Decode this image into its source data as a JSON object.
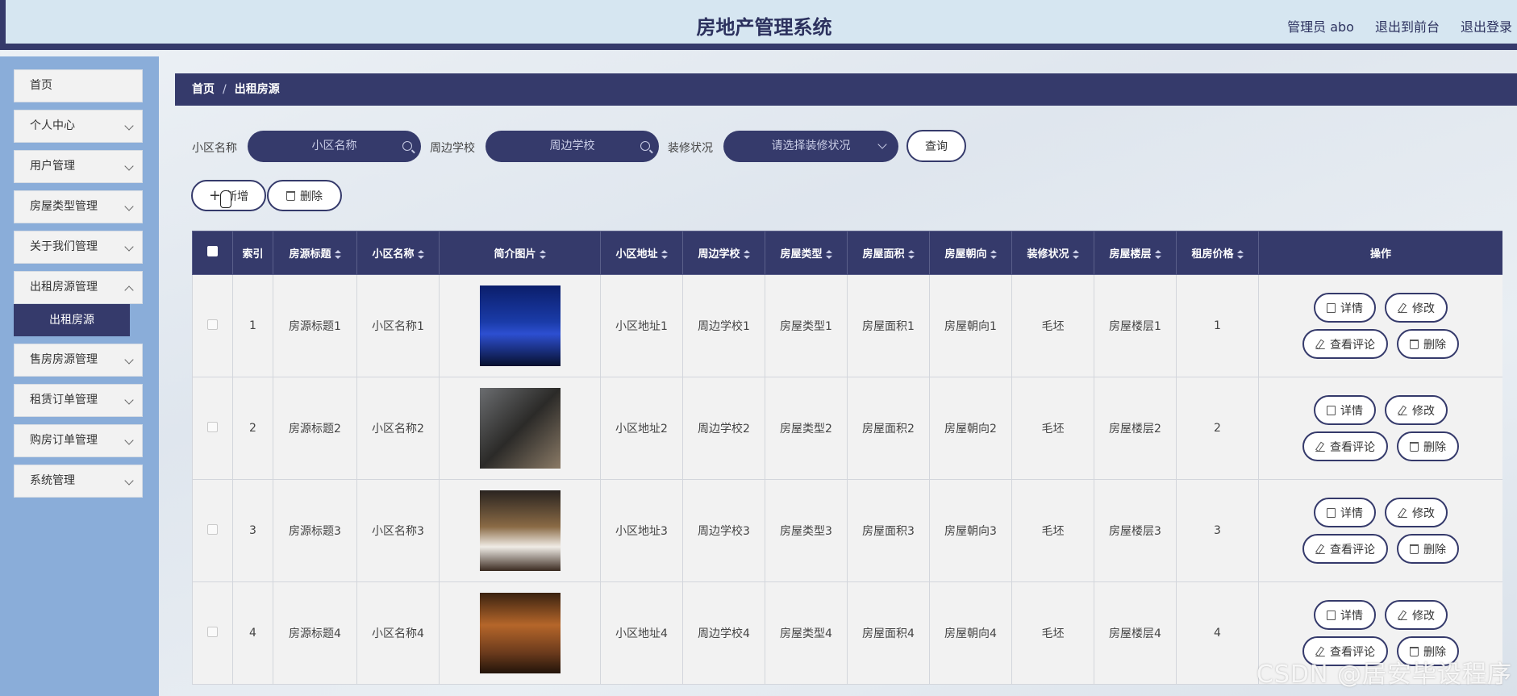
{
  "header": {
    "title": "房地产管理系统",
    "admin_label": "管理员 abo",
    "front_label": "退出到前台",
    "logout_label": "退出登录"
  },
  "sidebar": {
    "items": [
      {
        "label": "首页",
        "has_children": false
      },
      {
        "label": "个人中心",
        "has_children": true
      },
      {
        "label": "用户管理",
        "has_children": true
      },
      {
        "label": "房屋类型管理",
        "has_children": true
      },
      {
        "label": "关于我们管理",
        "has_children": true
      },
      {
        "label": "出租房源管理",
        "has_children": true
      },
      {
        "label": "售房房源管理",
        "has_children": true
      },
      {
        "label": "租赁订单管理",
        "has_children": true
      },
      {
        "label": "购房订单管理",
        "has_children": true
      },
      {
        "label": "系统管理",
        "has_children": true
      }
    ],
    "active_sub": "出租房源"
  },
  "breadcrumb": {
    "home": "首页",
    "sep": "/",
    "current": "出租房源"
  },
  "search": {
    "community_label": "小区名称",
    "community_placeholder": "小区名称",
    "school_label": "周边学校",
    "school_placeholder": "周边学校",
    "decoration_label": "装修状况",
    "decoration_placeholder": "请选择装修状况",
    "query_button": "查询"
  },
  "actions": {
    "add_label": "新增",
    "delete_label": "删除"
  },
  "table": {
    "columns": [
      "索引",
      "房源标题",
      "小区名称",
      "简介图片",
      "小区地址",
      "周边学校",
      "房屋类型",
      "房屋面积",
      "房屋朝向",
      "装修状况",
      "房屋楼层",
      "租房价格",
      "操作"
    ],
    "rows": [
      {
        "index": "1",
        "title": "房源标题1",
        "community": "小区名称1",
        "address": "小区地址1",
        "school": "周边学校1",
        "type": "房屋类型1",
        "area": "房屋面积1",
        "orientation": "房屋朝向1",
        "decoration": "毛坯",
        "floor": "房屋楼层1",
        "price": "1"
      },
      {
        "index": "2",
        "title": "房源标题2",
        "community": "小区名称2",
        "address": "小区地址2",
        "school": "周边学校2",
        "type": "房屋类型2",
        "area": "房屋面积2",
        "orientation": "房屋朝向2",
        "decoration": "毛坯",
        "floor": "房屋楼层2",
        "price": "2"
      },
      {
        "index": "3",
        "title": "房源标题3",
        "community": "小区名称3",
        "address": "小区地址3",
        "school": "周边学校3",
        "type": "房屋类型3",
        "area": "房屋面积3",
        "orientation": "房屋朝向3",
        "decoration": "毛坯",
        "floor": "房屋楼层3",
        "price": "3"
      },
      {
        "index": "4",
        "title": "房源标题4",
        "community": "小区名称4",
        "address": "小区地址4",
        "school": "周边学校4",
        "type": "房屋类型4",
        "area": "房屋面积4",
        "orientation": "房屋朝向4",
        "decoration": "毛坯",
        "floor": "房屋楼层4",
        "price": "4"
      }
    ],
    "op_labels": {
      "detail": "详情",
      "edit": "修改",
      "comments": "查看评论",
      "delete": "删除"
    }
  },
  "watermark": "CSDN @居安毕设程序",
  "colors": {
    "primary": "#353a6b",
    "sidebar_bg": "#8aadd9",
    "header_bg": "#d6e6f1"
  }
}
